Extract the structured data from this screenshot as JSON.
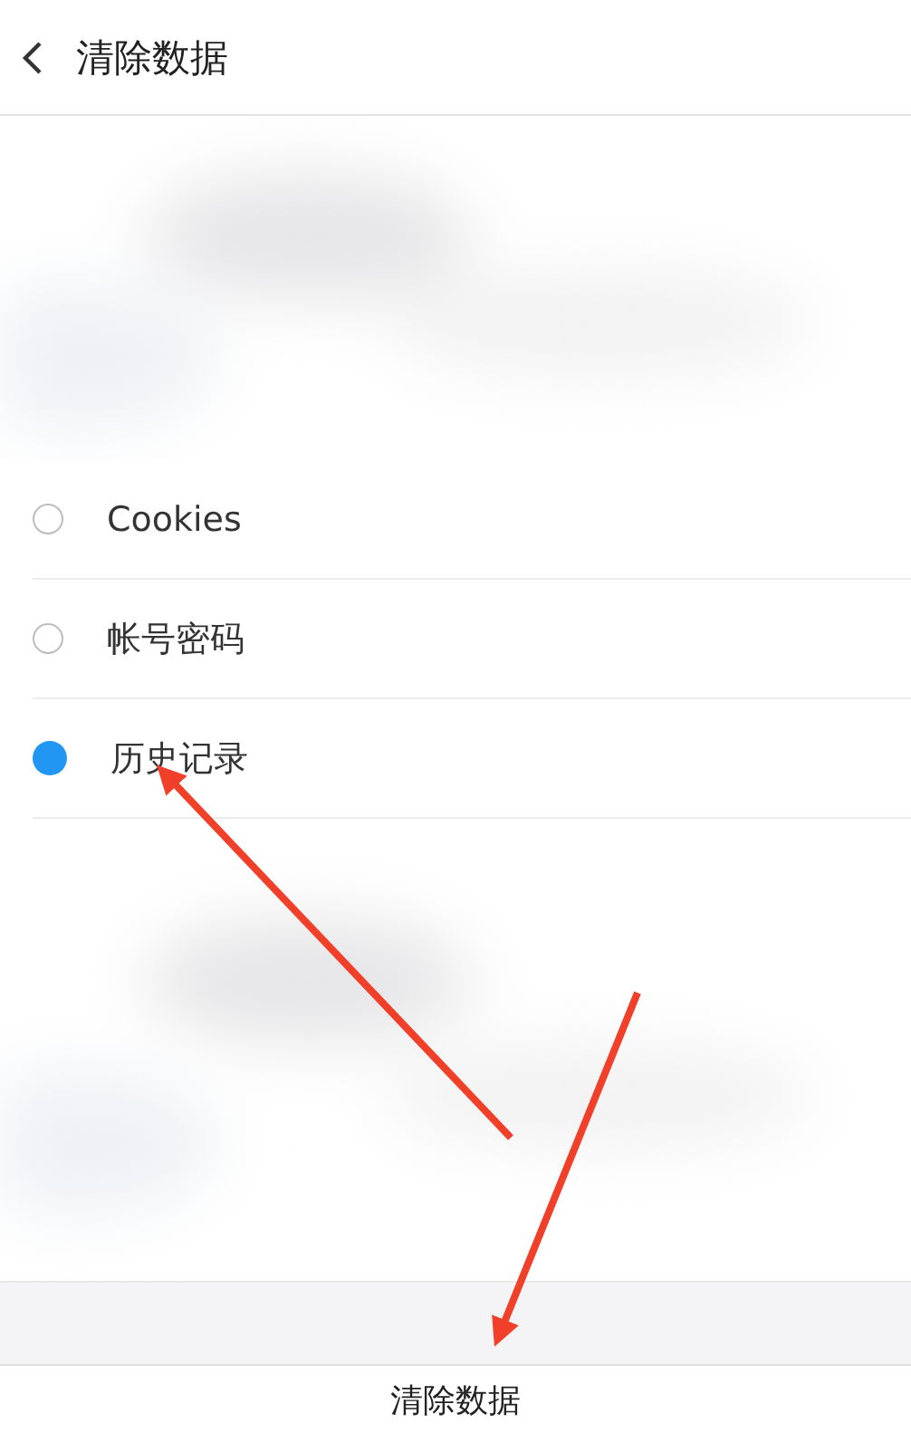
{
  "header": {
    "title": "清除数据"
  },
  "options": [
    {
      "label": "Cookies",
      "selected": false
    },
    {
      "label": "帐号密码",
      "selected": false
    },
    {
      "label": "历史记录",
      "selected": true
    }
  ],
  "action": {
    "label": "清除数据"
  }
}
